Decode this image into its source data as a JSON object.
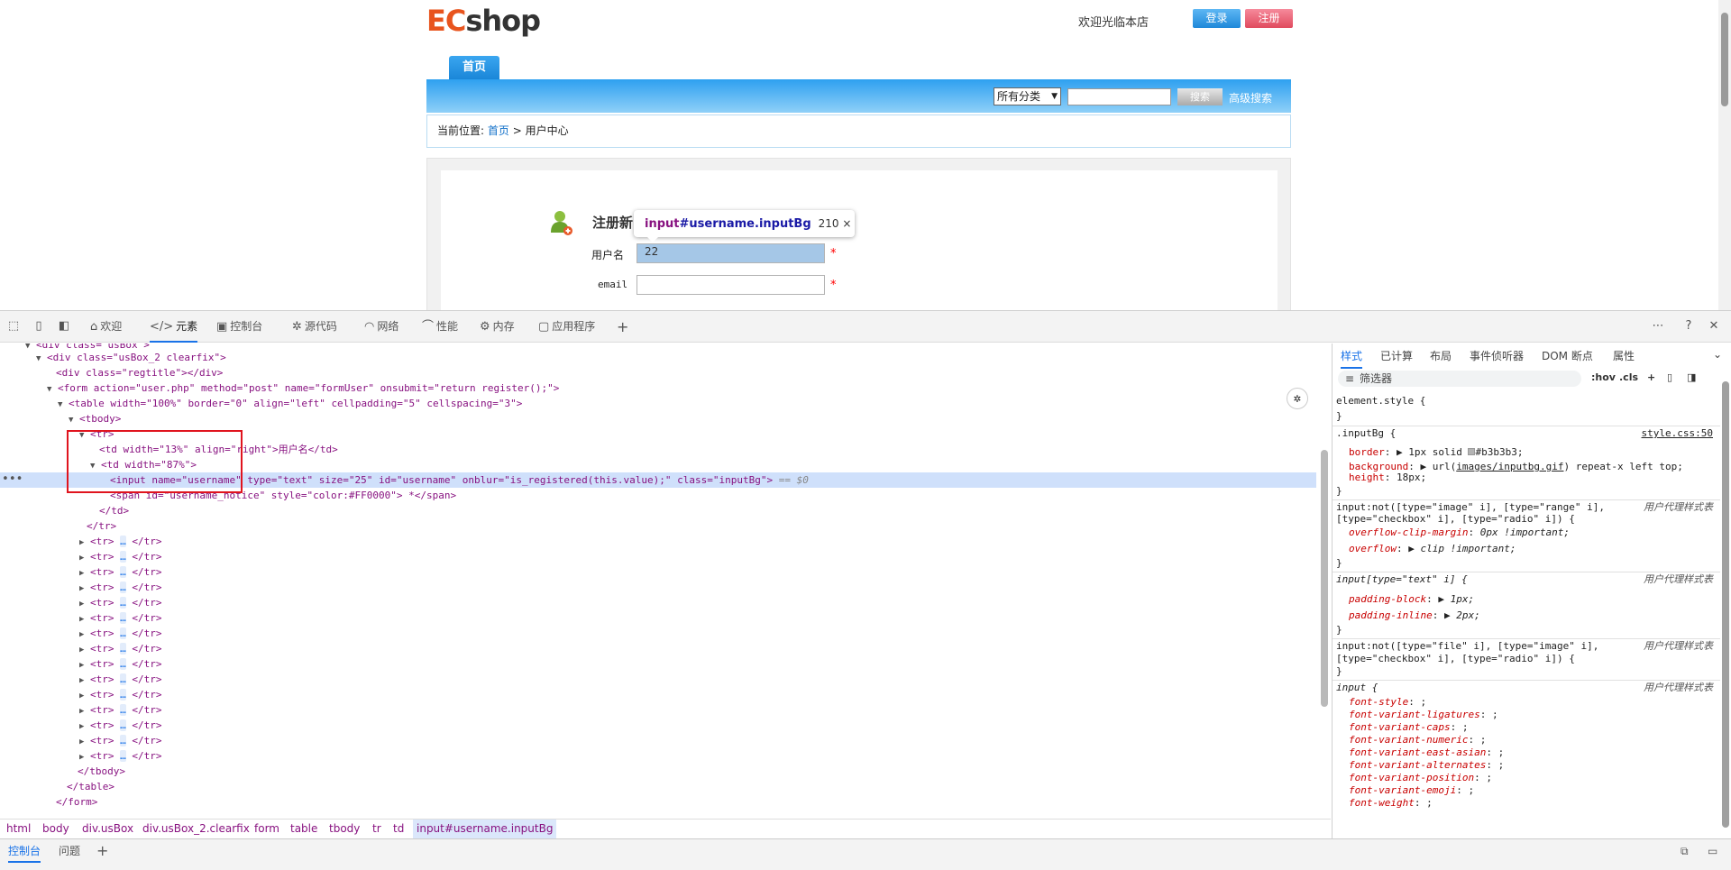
{
  "page": {
    "logo_ec": "EC",
    "logo_shop": "shop",
    "welcome": "欢迎光临本店",
    "login_label": "登录",
    "register_label": "注册",
    "nav_home": "首页",
    "category_value": "所有分类",
    "search_button": "搜索",
    "advanced_search": "高级搜索",
    "breadcrumb_prefix": "当前位置:",
    "breadcrumb_home": "首页",
    "breadcrumb_sep": ">",
    "breadcrumb_current": "用户中心",
    "register_title": "注册新",
    "username_label": "用户名",
    "email_label": "email",
    "required_mark": "*",
    "tooltip_tag": "input",
    "tooltip_id_class": "#username.inputBg",
    "tooltip_size": "210 × 22"
  },
  "devtools": {
    "tabs": [
      "欢迎",
      "元素",
      "控制台",
      "源代码",
      "网络",
      "性能",
      "内存",
      "应用程序"
    ],
    "active_tab": "元素",
    "tree": [
      "<div class=\"usBox\">",
      "<div class=\"usBox_2 clearfix\">",
      "<div class=\"regtitle\"></div>",
      "<form action=\"user.php\" method=\"post\" name=\"formUser\" onsubmit=\"return register();\">",
      "<table width=\"100%\" border=\"0\" align=\"left\" cellpadding=\"5\" cellspacing=\"3\">",
      "<tbody>",
      "<tr>",
      "<td width=\"13%\" align=\"right\">用户名</td>",
      "<td width=\"87%\">",
      "<input name=\"username\" type=\"text\" size=\"25\" id=\"username\" onblur=\"is_registered(this.value);\" class=\"inputBg\">",
      "== $0",
      "<span id=\"username_notice\" style=\"color:#FF0000\"> *</span>",
      "</td>",
      "</tr>",
      "<tr>",
      "</tr>",
      "</tbody>",
      "</table>",
      "</form>"
    ],
    "breadcrumbs": [
      "html",
      "body",
      "div.usBox",
      "div.usBox_2.clearfix",
      "form",
      "table",
      "tbody",
      "tr",
      "td",
      "input#username.inputBg"
    ],
    "style_tabs": [
      "样式",
      "已计算",
      "布局",
      "事件侦听器",
      "DOM 断点",
      "属性"
    ],
    "filter_placeholder": "筛选器",
    "hov": ":hov",
    "cls": ".cls",
    "styles": {
      "element_style": "element.style {",
      "close": "}",
      "inputbg_selector": ".inputBg {",
      "inputbg_source": "style.css:50",
      "border_prop": "border",
      "border_val": "1px solid",
      "border_color": "#b3b3b3",
      "background_prop": "background",
      "background_val_pre": "url(",
      "background_link": "images/inputbg.gif",
      "background_val_post": ") repeat-x left top;",
      "height_prop": "height",
      "height_val": "18px;",
      "ua_label": "用户代理样式表",
      "rule2_sel_a": "input:not([type=\"image\" i], [type=\"range\" i],",
      "rule2_sel_b": "[type=\"checkbox\" i], [type=\"radio\" i]) {",
      "overflow_clip_prop": "overflow-clip-margin",
      "overflow_clip_val": "0px !important;",
      "overflow_prop": "overflow",
      "overflow_val": "clip !important;",
      "rule3_sel": "input[type=\"text\" i] {",
      "padding_block_prop": "padding-block",
      "padding_block_val": "1px;",
      "padding_inline_prop": "padding-inline",
      "padding_inline_val": "2px;",
      "rule4_sel_a": "input:not([type=\"file\" i], [type=\"image\" i],",
      "rule4_sel_b": "[type=\"checkbox\" i], [type=\"radio\" i]) {",
      "rule5_sel": "input {",
      "font_props": [
        "font-style",
        "font-variant-ligatures",
        "font-variant-caps",
        "font-variant-numeric",
        "font-variant-east-asian",
        "font-variant-alternates",
        "font-variant-position",
        "font-variant-emoji",
        "font-weight"
      ]
    },
    "drawer_tabs": [
      "控制台",
      "问题"
    ]
  },
  "colors": {
    "accent": "#1a73e8",
    "nav_blue": "#2ea0f0",
    "highlight_red": "#e0141e",
    "input_highlight": "#a5c7e7"
  }
}
